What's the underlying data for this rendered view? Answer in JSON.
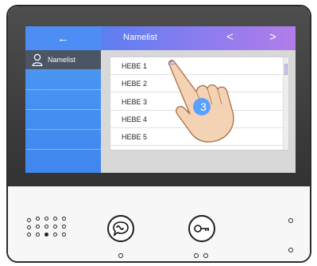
{
  "topbar": {
    "back_icon": "←",
    "title": "Namelist",
    "prev_icon": "<",
    "next_icon": ">"
  },
  "sidebar": {
    "items": [
      {
        "label": "Namelist",
        "icon": "user-icon",
        "selected": true
      }
    ]
  },
  "namelist": {
    "entries": [
      "HEBE 1",
      "HEBE 2",
      "HEBE 3",
      "HEBE 4",
      "HEBE 5"
    ]
  },
  "annotation": {
    "step_number": "3"
  },
  "controls": {
    "buttons": [
      {
        "name": "talk-button",
        "icon": "speech-bubble-icon"
      },
      {
        "name": "unlock-button",
        "icon": "key-icon"
      }
    ]
  },
  "colors": {
    "accent_blue": "#4e8ef4",
    "gradient_purple": "#b17de8",
    "sidebar_selected": "#4a5566",
    "step_badge": "#5aa0ff"
  }
}
